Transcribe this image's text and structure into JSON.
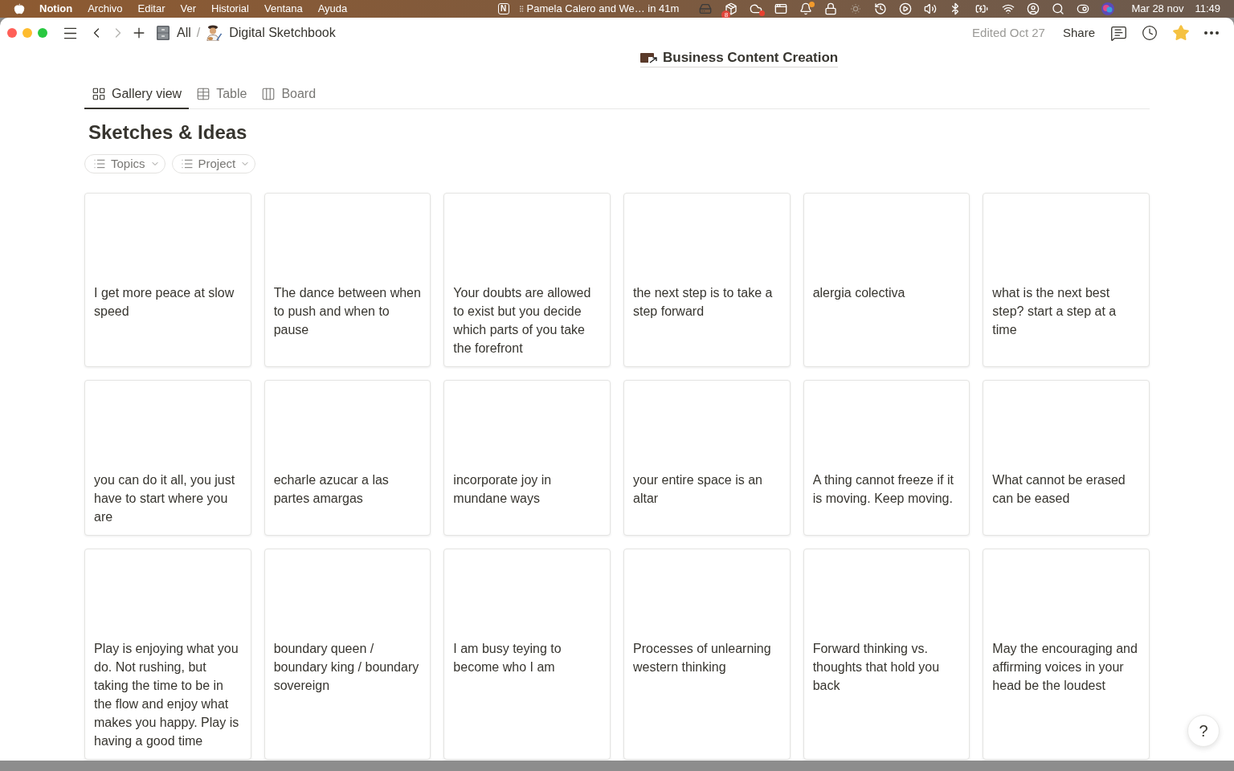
{
  "menu_bar": {
    "app_name": "Notion",
    "menus": [
      "Archivo",
      "Editar",
      "Ver",
      "Historial",
      "Ventana",
      "Ayuda"
    ],
    "status_logo": "N",
    "event": "Pamela Calero and We… in 41m",
    "badge": "8",
    "date": "Mar 28 nov",
    "time": "11:49"
  },
  "toolbar": {
    "nav": [
      {
        "kind": "back",
        "disabled": false
      },
      {
        "kind": "forward",
        "disabled": true
      }
    ],
    "breadcrumbs": [
      {
        "kind": "cabinet",
        "label": "All"
      },
      {
        "kind": "artist",
        "label": "Digital Sketchbook"
      }
    ],
    "separator": "/",
    "edited": "Edited Oct 27",
    "share": "Share",
    "favorite": true
  },
  "parent_link": {
    "label": "Business Content Creation"
  },
  "views": [
    {
      "kind": "gallery",
      "label": "Gallery view",
      "selected": true
    },
    {
      "kind": "table",
      "label": "Table",
      "selected": false
    },
    {
      "kind": "board",
      "label": "Board",
      "selected": false
    }
  ],
  "database": {
    "title": "Sketches & Ideas",
    "filters": [
      {
        "label": "Topics"
      },
      {
        "label": "Project"
      }
    ]
  },
  "cards": [
    {
      "title": "I get more peace at slow speed"
    },
    {
      "title": "The dance between when to push and when to pause"
    },
    {
      "title": "Your doubts are allowed to exist but you decide which parts of you take the forefront"
    },
    {
      "title": "the next step is to take a step forward"
    },
    {
      "title": "alergia colectiva"
    },
    {
      "title": "what is the next best step? start a step at a time"
    },
    {
      "title": "you can do it all, you just have to start where you are"
    },
    {
      "title": "echarle azucar a las partes amargas"
    },
    {
      "title": "incorporate joy in mundane ways"
    },
    {
      "title": "your entire space is an altar"
    },
    {
      "title": "A thing cannot freeze if it is moving. Keep moving."
    },
    {
      "title": "What cannot be erased can be eased"
    },
    {
      "title": "Play is enjoying what you do. Not rushing, but taking the time to be in the flow and enjoy what makes you happy. Play is having a good time"
    },
    {
      "title": "boundary queen / boundary king / boundary sovereign"
    },
    {
      "title": "I am busy teying to become who I am"
    },
    {
      "title": "Processes of unlearning western thinking"
    },
    {
      "title": "Forward thinking vs. thoughts that hold you back"
    },
    {
      "title": "May the encouraging and affirming voices in your head be the loudest"
    }
  ],
  "help_button": "?"
}
